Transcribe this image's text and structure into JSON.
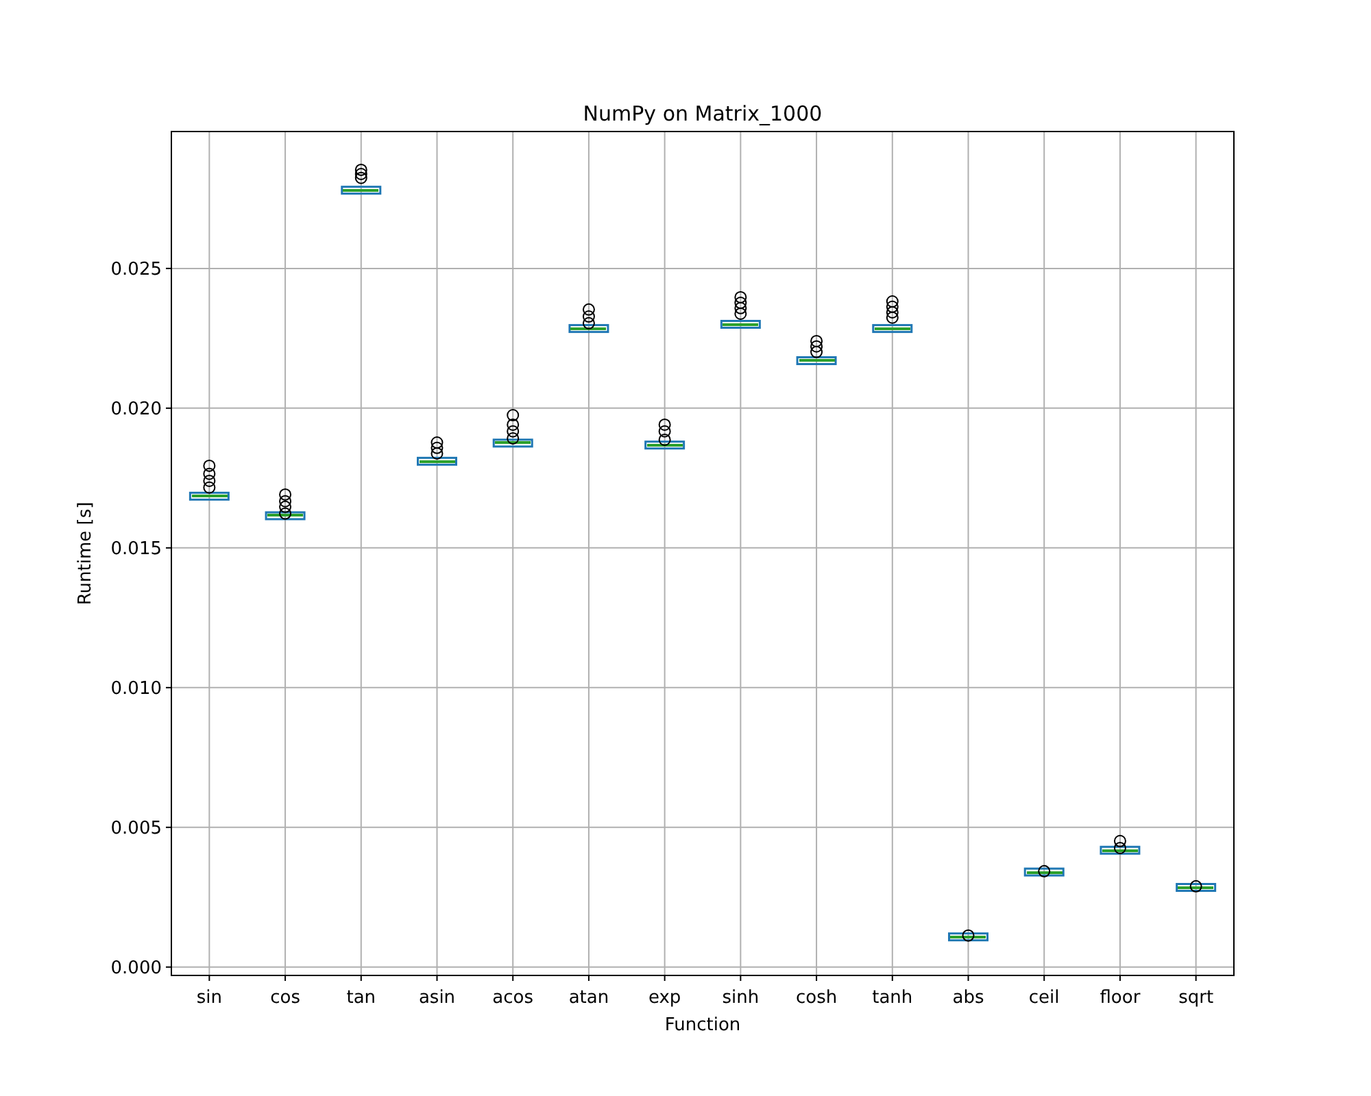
{
  "figure": {
    "chart_data": {
      "type": "scatter",
      "title": "NumPy on Matrix_1000",
      "xlabel": "Function",
      "ylabel": "Runtime [s]",
      "categories": [
        "sin",
        "cos",
        "tan",
        "asin",
        "acos",
        "atan",
        "exp",
        "sinh",
        "cosh",
        "tanh",
        "abs",
        "ceil",
        "floor",
        "sqrt"
      ],
      "series": [
        {
          "color": "#000000",
          "values": [
            0.01794,
            0.01691,
            0.02853,
            0.01877,
            0.01975,
            0.02353,
            0.01941,
            0.02397,
            0.0224,
            0.02382,
            0.00113,
            0.00343,
            0.00451,
            0.00289
          ]
        },
        {
          "color": "#000000",
          "values": [
            0.01765,
            0.01667,
            0.02838,
            0.01858,
            0.01941,
            0.02328,
            0.01917,
            0.02377,
            0.02221,
            0.02363,
            null,
            null,
            0.00426,
            null
          ]
        },
        {
          "color": "#000000",
          "values": [
            0.0174,
            0.01647,
            0.02824,
            0.01838,
            0.01917,
            0.02304,
            0.01887,
            0.02358,
            0.02201,
            0.02343,
            null,
            null,
            null,
            null
          ]
        },
        {
          "color": "#000000",
          "values": [
            0.01716,
            0.01623,
            null,
            null,
            0.01892,
            null,
            null,
            0.02338,
            null,
            0.02324,
            null,
            null,
            null,
            null
          ]
        }
      ],
      "ylim": [
        -0.0003,
        0.0299
      ],
      "grid": true,
      "yticks": [
        {
          "value": 0,
          "label": "0.000"
        },
        {
          "value": 0.005,
          "label": "0.005"
        },
        {
          "value": 0.01,
          "label": "0.010"
        },
        {
          "value": 0.015,
          "label": "0.015"
        },
        {
          "value": 0.02,
          "label": "0.020"
        },
        {
          "value": 0.025,
          "label": "0.025"
        }
      ]
    }
  }
}
